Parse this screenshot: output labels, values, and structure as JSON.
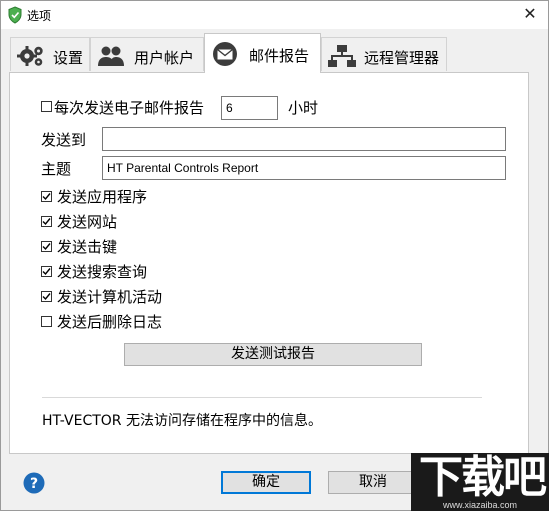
{
  "window": {
    "title": "选项",
    "close_glyph": "✕",
    "app_icon": "shield-icon"
  },
  "tabs": [
    {
      "label": "设置",
      "icon": "gears-icon",
      "active": false
    },
    {
      "label": "用户帐户",
      "icon": "users-icon",
      "active": false
    },
    {
      "label": "邮件报告",
      "icon": "mail-icon",
      "active": true
    },
    {
      "label": "远程管理器",
      "icon": "network-icon",
      "active": false
    }
  ],
  "email": {
    "send_every_label": "每次发送电子邮件报告",
    "send_every_checked": false,
    "hours_value": "6",
    "hours_unit": "小时",
    "send_to_label": "发送到",
    "send_to_value": "",
    "subject_label": "主题",
    "subject_value": "HT Parental Controls Report",
    "options": [
      {
        "label": "发送应用程序",
        "checked": true
      },
      {
        "label": "发送网站",
        "checked": true
      },
      {
        "label": "发送击键",
        "checked": true
      },
      {
        "label": "发送搜索查询",
        "checked": true
      },
      {
        "label": "发送计算机活动",
        "checked": true
      },
      {
        "label": "发送后删除日志",
        "checked": false
      }
    ],
    "test_button": "发送测试报告",
    "info_text": "HT-VECTOR 无法访问存储在程序中的信息。"
  },
  "footer": {
    "ok_button": "确定",
    "cancel_button": "取消",
    "help_glyph": "?"
  },
  "watermark": {
    "big": "下载吧",
    "small": "www.xiazaiba.com"
  },
  "colors": {
    "accent": "#0078d7",
    "help_blue": "#1e6bb8",
    "icon_dark": "#3c3c3c"
  }
}
